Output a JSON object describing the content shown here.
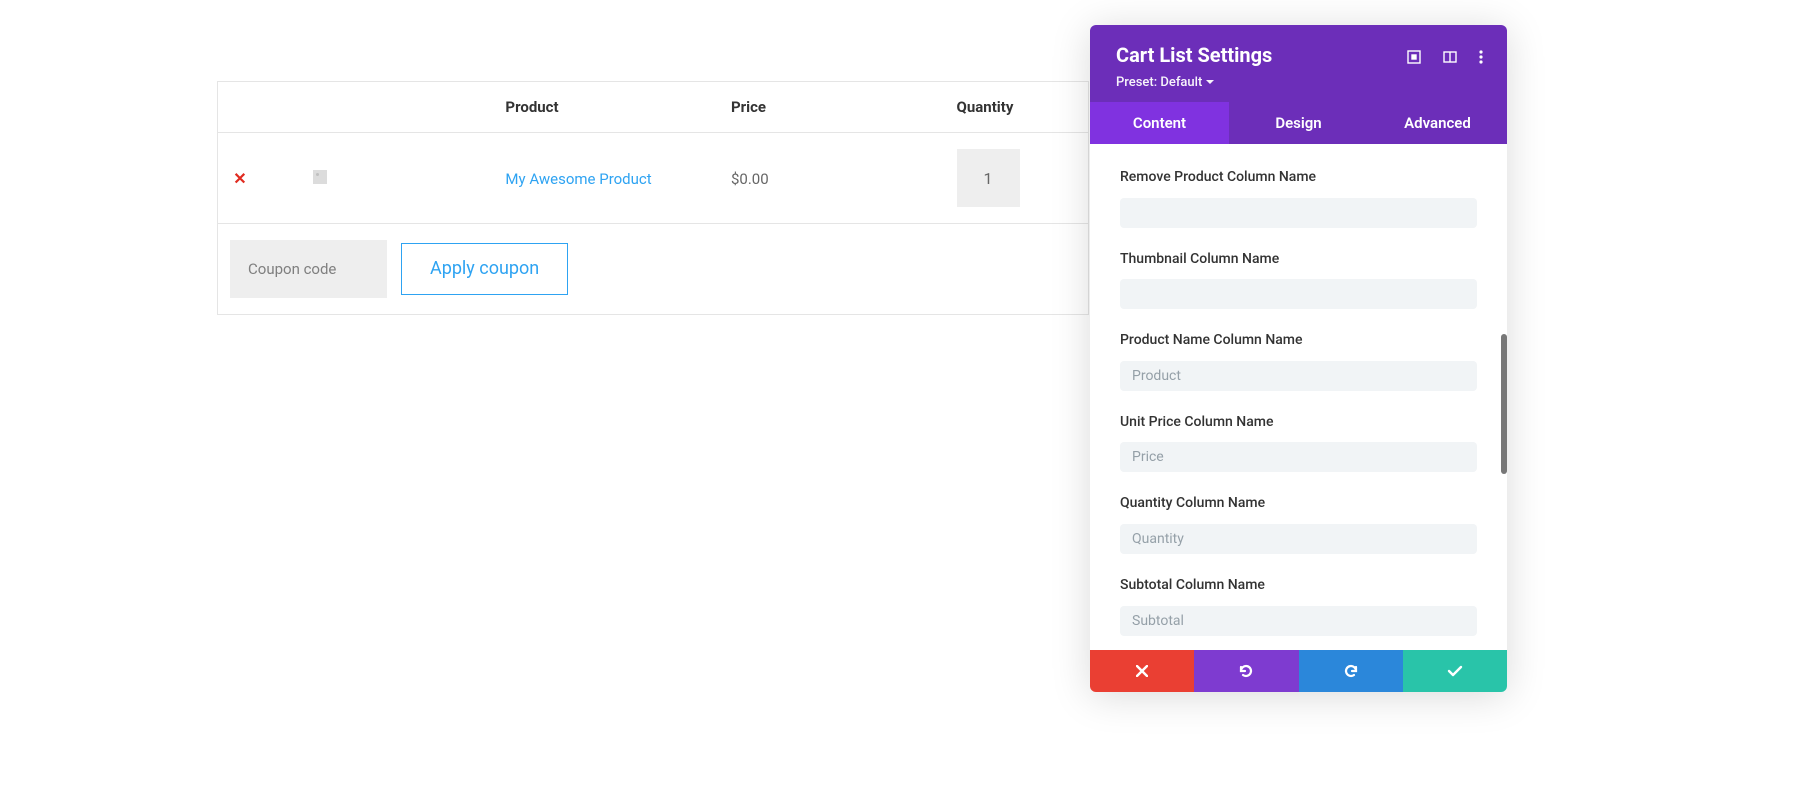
{
  "cart": {
    "headers": {
      "product": "Product",
      "price": "Price",
      "quantity": "Quantity"
    },
    "row": {
      "product_name": "My Awesome Product",
      "price": "$0.00",
      "quantity": "1"
    },
    "coupon_placeholder": "Coupon code",
    "apply_label": "Apply coupon"
  },
  "panel": {
    "title": "Cart List Settings",
    "preset": "Preset: Default",
    "tabs": {
      "content": "Content",
      "design": "Design",
      "advanced": "Advanced"
    },
    "fields": {
      "remove_label": "Remove Product Column Name",
      "remove_value": "",
      "thumbnail_label": "Thumbnail Column Name",
      "thumbnail_value": "",
      "productname_label": "Product Name Column Name",
      "productname_placeholder": "Product",
      "unitprice_label": "Unit Price Column Name",
      "unitprice_placeholder": "Price",
      "quantity_label": "Quantity Column Name",
      "quantity_placeholder": "Quantity",
      "subtotal_label": "Subtotal Column Name",
      "subtotal_placeholder": "Subtotal"
    }
  }
}
